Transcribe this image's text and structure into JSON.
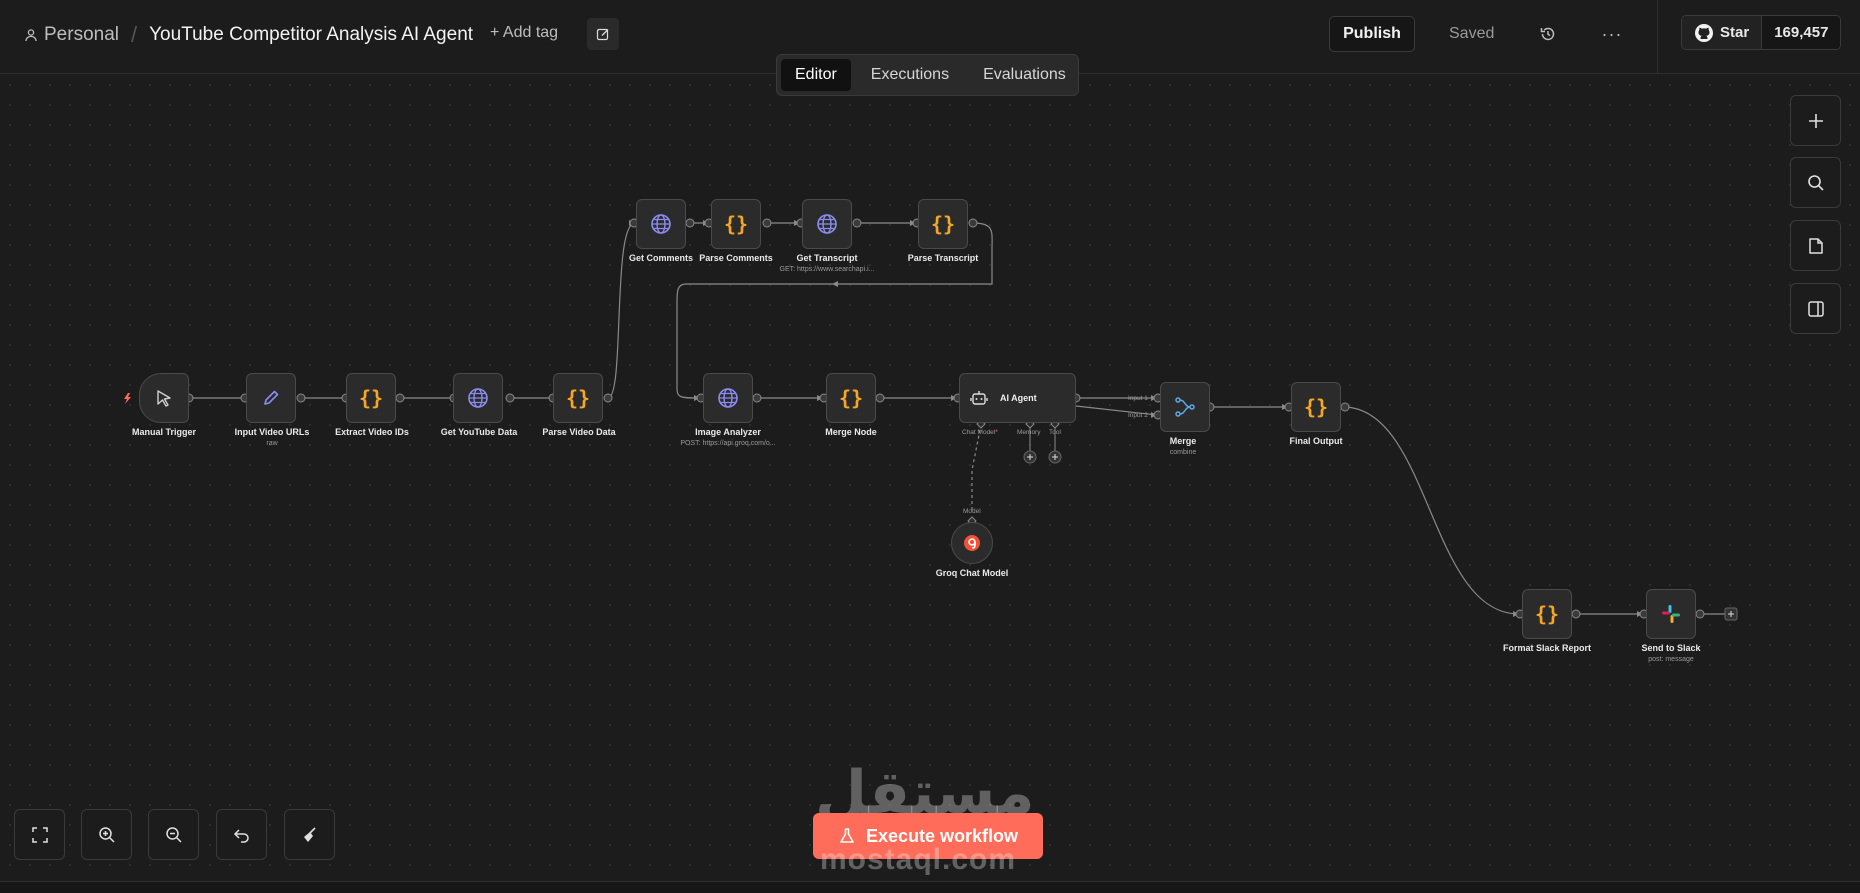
{
  "header": {
    "breadcrumb_project": "Personal",
    "workflow_title": "YouTube Competitor Analysis AI Agent",
    "add_tag": "+ Add tag",
    "publish": "Publish",
    "saved": "Saved",
    "github_star": "Star",
    "github_count": "169,457"
  },
  "tabs": [
    {
      "label": "Editor",
      "active": true
    },
    {
      "label": "Executions",
      "active": false
    },
    {
      "label": "Evaluations",
      "active": false
    }
  ],
  "nodes": {
    "manual_trigger": {
      "label": "Manual Trigger",
      "icon": "cursor-icon"
    },
    "input_video_urls": {
      "label": "Input Video URLs",
      "sub": "raw",
      "icon": "pencil-icon"
    },
    "extract_video_ids": {
      "label": "Extract Video IDs",
      "icon": "code-icon"
    },
    "get_youtube_data": {
      "label": "Get YouTube Data",
      "icon": "globe-icon"
    },
    "parse_video_data": {
      "label": "Parse Video Data",
      "icon": "code-icon"
    },
    "get_comments": {
      "label": "Get Comments",
      "icon": "globe-icon"
    },
    "parse_comments": {
      "label": "Parse Comments",
      "icon": "code-icon"
    },
    "get_transcript": {
      "label": "Get Transcript",
      "sub": "GET: https://www.searchapi.i...",
      "icon": "globe-icon"
    },
    "parse_transcript": {
      "label": "Parse Transcript",
      "icon": "code-icon"
    },
    "image_analyzer": {
      "label": "Image Analyzer",
      "sub": "POST: https://api.groq.com/o...",
      "icon": "globe-icon"
    },
    "merge_node": {
      "label": "Merge Node",
      "icon": "code-icon"
    },
    "ai_agent": {
      "label": "AI Agent",
      "icon": "robot-icon",
      "ports": [
        "Chat Model",
        "Memory",
        "Tool"
      ]
    },
    "merge": {
      "label": "Merge",
      "sub": "combine",
      "icon": "merge-icon",
      "inputs": [
        "Input 1",
        "Input 2"
      ]
    },
    "final_output": {
      "label": "Final Output",
      "icon": "code-icon"
    },
    "groq_chat_model": {
      "label": "Groq Chat Model",
      "port": "Model",
      "icon": "groq-icon"
    },
    "format_slack_report": {
      "label": "Format Slack Report",
      "icon": "code-icon"
    },
    "send_to_slack": {
      "label": "Send to Slack",
      "sub": "post: message",
      "icon": "slack-icon"
    }
  },
  "execute_button": "Execute workflow",
  "watermark": {
    "arabic": "مستقل",
    "latin": "mostaql.com"
  },
  "colors": {
    "accent": "#ff6d5a",
    "code": "#f5a623",
    "globe": "#8b8cf0",
    "background": "#1c1c1c"
  }
}
